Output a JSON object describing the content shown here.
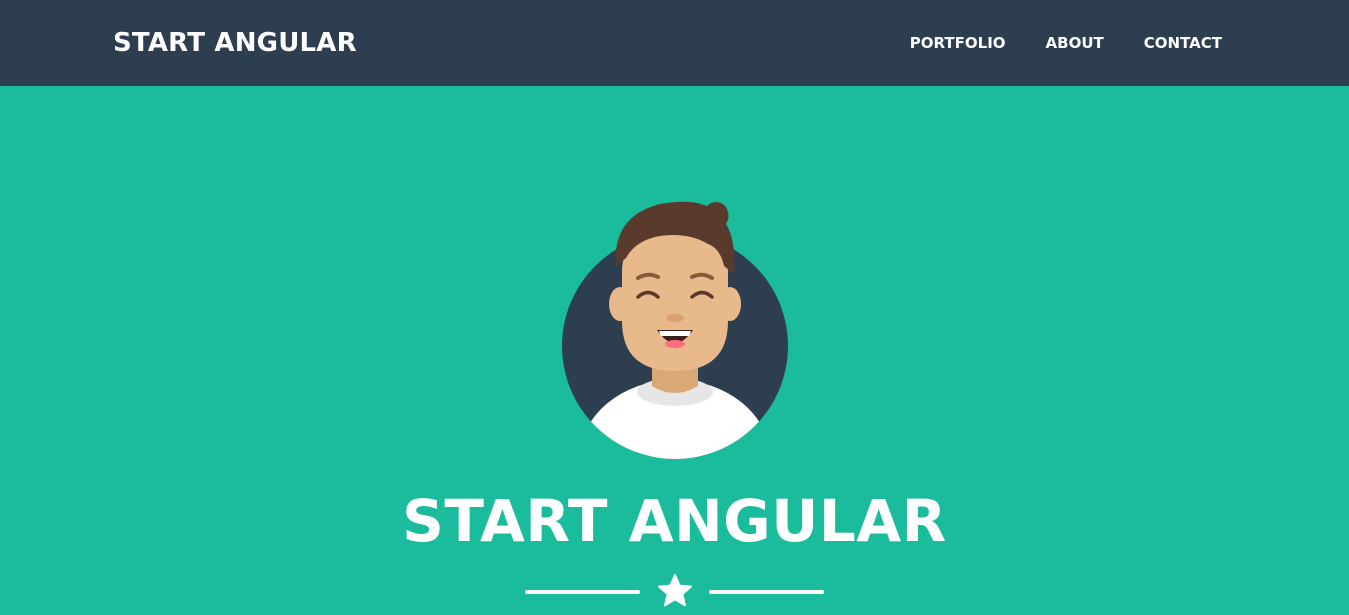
{
  "navbar": {
    "brand": "START ANGULAR",
    "links": [
      {
        "label": "PORTFOLIO"
      },
      {
        "label": "ABOUT"
      },
      {
        "label": "CONTACT"
      }
    ]
  },
  "hero": {
    "avatar_icon": "smiling-person-avatar-icon",
    "title": "START ANGULAR",
    "divider_icon": "star-icon"
  },
  "colors": {
    "navbar_bg": "#2c3e50",
    "hero_bg": "#1abc9c",
    "text": "#ffffff"
  }
}
